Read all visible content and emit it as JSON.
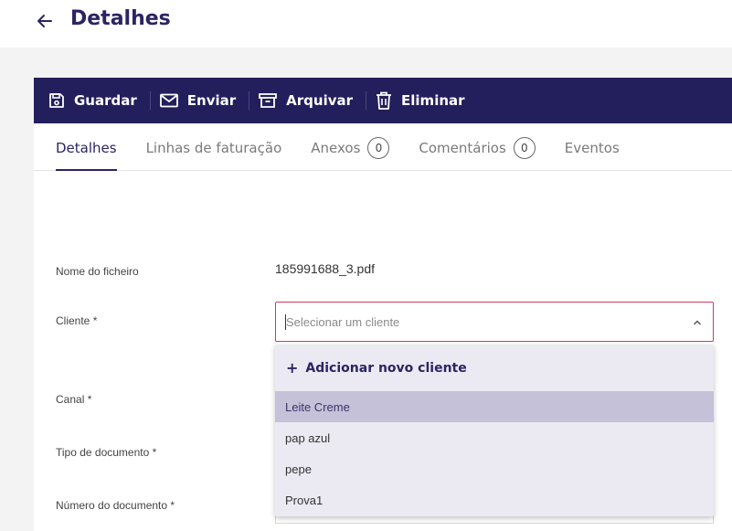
{
  "header": {
    "title": "Detalhes"
  },
  "toolbar": {
    "save_label": "Guardar",
    "send_label": "Enviar",
    "archive_label": "Arquivar",
    "delete_label": "Eliminar"
  },
  "tabs": [
    {
      "label": "Detalhes"
    },
    {
      "label": "Linhas de faturação"
    },
    {
      "label": "Anexos",
      "count": "0"
    },
    {
      "label": "Comentários",
      "count": "0"
    },
    {
      "label": "Eventos"
    }
  ],
  "form": {
    "filename_label": "Nome do ficheiro",
    "filename_value": "185991688_3.pdf",
    "client_label": "Cliente *",
    "client_placeholder": "Selecionar um cliente",
    "channel_label": "Canal *",
    "doctype_label": "Tipo de documento *",
    "docnumber_label": "Número do documento *"
  },
  "dropdown": {
    "add_label": "Adicionar novo cliente",
    "options": [
      "Leite Creme",
      "pap azul",
      "pepe",
      "Prova1"
    ]
  },
  "colors": {
    "brand": "#231f5c",
    "title": "#2b2464",
    "error_border": "#d2385f",
    "highlight": "#c5c1d9"
  }
}
